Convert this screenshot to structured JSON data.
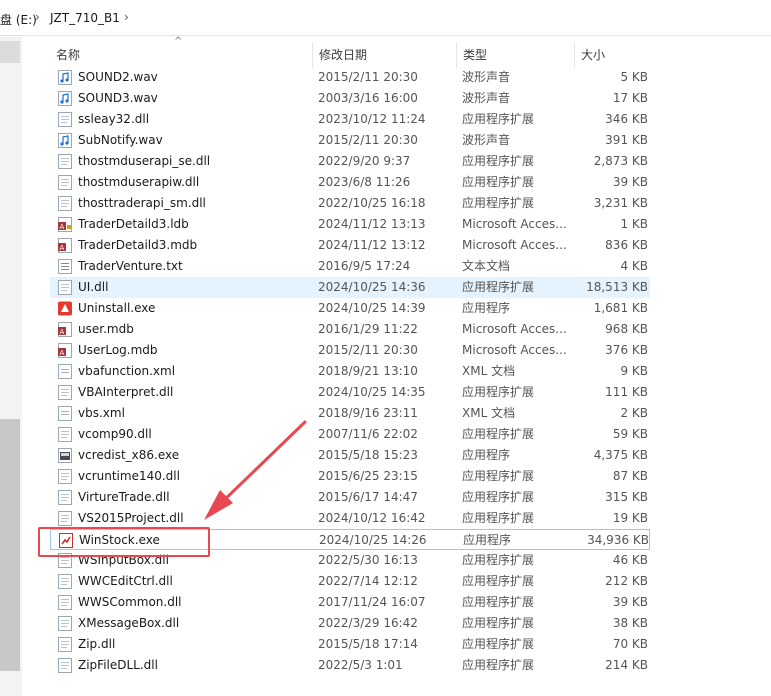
{
  "breadcrumb": {
    "drive": "盘 (E:)",
    "folder": "JZT_710_B1"
  },
  "columns": {
    "name": "名称",
    "date": "修改日期",
    "type": "类型",
    "size": "大小"
  },
  "files": [
    {
      "name": "SOUND2.wav",
      "date": "2015/2/11 20:30",
      "type": "波形声音",
      "size": "5 KB",
      "icon": "audio"
    },
    {
      "name": "SOUND3.wav",
      "date": "2003/3/16 16:00",
      "type": "波形声音",
      "size": "17 KB",
      "icon": "audio"
    },
    {
      "name": "ssleay32.dll",
      "date": "2023/10/12 11:24",
      "type": "应用程序扩展",
      "size": "346 KB",
      "icon": "dll"
    },
    {
      "name": "SubNotify.wav",
      "date": "2015/2/11 20:30",
      "type": "波形声音",
      "size": "391 KB",
      "icon": "audio"
    },
    {
      "name": "thostmduserapi_se.dll",
      "date": "2022/9/20 9:37",
      "type": "应用程序扩展",
      "size": "2,873 KB",
      "icon": "dll"
    },
    {
      "name": "thostmduserapiw.dll",
      "date": "2023/6/8 11:26",
      "type": "应用程序扩展",
      "size": "39 KB",
      "icon": "dll"
    },
    {
      "name": "thosttraderapi_sm.dll",
      "date": "2022/10/25 16:18",
      "type": "应用程序扩展",
      "size": "3,231 KB",
      "icon": "dll"
    },
    {
      "name": "TraderDetaild3.ldb",
      "date": "2024/11/12 13:13",
      "type": "Microsoft Acces...",
      "size": "1 KB",
      "icon": "access-lock"
    },
    {
      "name": "TraderDetaild3.mdb",
      "date": "2024/11/12 13:12",
      "type": "Microsoft Acces...",
      "size": "836 KB",
      "icon": "access"
    },
    {
      "name": "TraderVenture.txt",
      "date": "2016/9/5 17:24",
      "type": "文本文档",
      "size": "4 KB",
      "icon": "text"
    },
    {
      "name": "UI.dll",
      "date": "2024/10/25 14:36",
      "type": "应用程序扩展",
      "size": "18,513 KB",
      "icon": "dll",
      "selected": true
    },
    {
      "name": "Uninstall.exe",
      "date": "2024/10/25 14:39",
      "type": "应用程序",
      "size": "1,681 KB",
      "icon": "uninstall"
    },
    {
      "name": "user.mdb",
      "date": "2016/1/29 11:22",
      "type": "Microsoft Acces...",
      "size": "968 KB",
      "icon": "access"
    },
    {
      "name": "UserLog.mdb",
      "date": "2015/2/11 20:30",
      "type": "Microsoft Acces...",
      "size": "376 KB",
      "icon": "access"
    },
    {
      "name": "vbafunction.xml",
      "date": "2018/9/21 13:10",
      "type": "XML 文档",
      "size": "9 KB",
      "icon": "xml"
    },
    {
      "name": "VBAInterpret.dll",
      "date": "2024/10/25 14:35",
      "type": "应用程序扩展",
      "size": "111 KB",
      "icon": "dll"
    },
    {
      "name": "vbs.xml",
      "date": "2018/9/16 23:11",
      "type": "XML 文档",
      "size": "2 KB",
      "icon": "xml"
    },
    {
      "name": "vcomp90.dll",
      "date": "2007/11/6 22:02",
      "type": "应用程序扩展",
      "size": "59 KB",
      "icon": "dll"
    },
    {
      "name": "vcredist_x86.exe",
      "date": "2015/5/18 15:23",
      "type": "应用程序",
      "size": "4,375 KB",
      "icon": "installer"
    },
    {
      "name": "vcruntime140.dll",
      "date": "2015/6/25 23:15",
      "type": "应用程序扩展",
      "size": "87 KB",
      "icon": "dll"
    },
    {
      "name": "VirtureTrade.dll",
      "date": "2015/6/17 14:47",
      "type": "应用程序扩展",
      "size": "315 KB",
      "icon": "dll"
    },
    {
      "name": "VS2015Project.dll",
      "date": "2024/10/12 16:42",
      "type": "应用程序扩展",
      "size": "19 KB",
      "icon": "dll"
    },
    {
      "name": "WinStock.exe",
      "date": "2024/10/25 14:26",
      "type": "应用程序",
      "size": "34,936 KB",
      "icon": "winstock",
      "highlighted": true
    },
    {
      "name": "WSInputBox.dll",
      "date": "2022/5/30 16:13",
      "type": "应用程序扩展",
      "size": "46 KB",
      "icon": "dll"
    },
    {
      "name": "WWCEditCtrl.dll",
      "date": "2022/7/14 12:12",
      "type": "应用程序扩展",
      "size": "212 KB",
      "icon": "dll"
    },
    {
      "name": "WWSCommon.dll",
      "date": "2017/11/24 16:07",
      "type": "应用程序扩展",
      "size": "39 KB",
      "icon": "dll"
    },
    {
      "name": "XMessageBox.dll",
      "date": "2022/3/29 16:42",
      "type": "应用程序扩展",
      "size": "38 KB",
      "icon": "dll"
    },
    {
      "name": "Zip.dll",
      "date": "2015/5/18 17:14",
      "type": "应用程序扩展",
      "size": "70 KB",
      "icon": "dll"
    },
    {
      "name": "ZipFileDLL.dll",
      "date": "2022/5/3 1:01",
      "type": "应用程序扩展",
      "size": "214 KB",
      "icon": "dll"
    }
  ],
  "colors": {
    "selection": "#e5f3ff",
    "highlight_border": "#99c9ef",
    "annotation": "#e8484f"
  }
}
